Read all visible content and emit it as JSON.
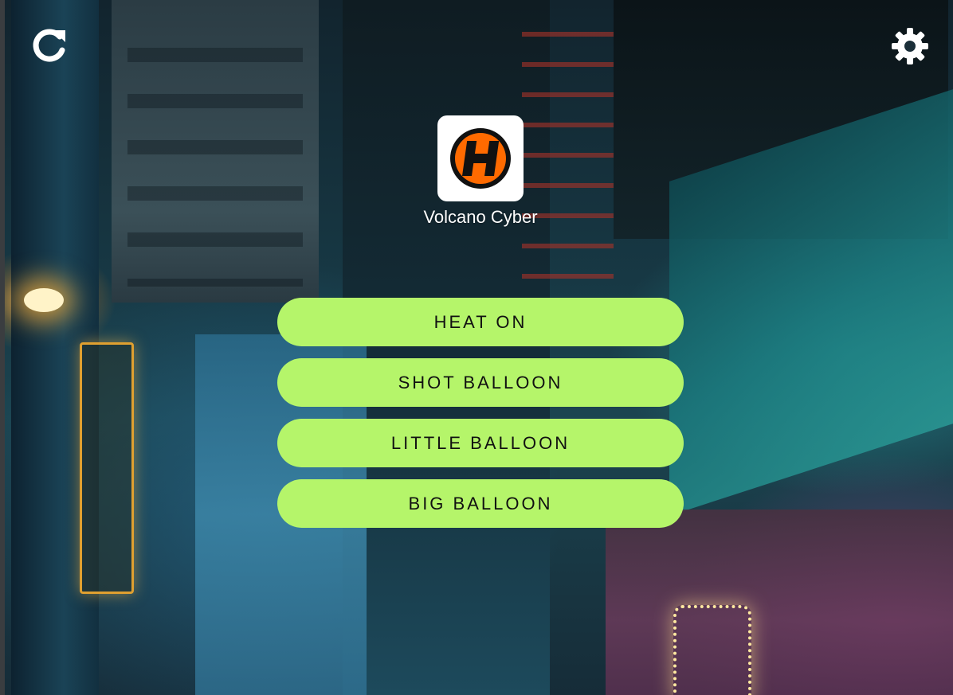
{
  "header": {
    "refresh_icon": "refresh-icon",
    "settings_icon": "gear-icon"
  },
  "device": {
    "name": "Volcano Cyber",
    "logo_icon": "volcano-logo-icon",
    "logo_colors": {
      "primary": "#ff6a00",
      "outline": "#111111"
    }
  },
  "actions": [
    {
      "id": "heat-on",
      "label": "HEAT ON"
    },
    {
      "id": "shot-balloon",
      "label": "SHOT BALLOON"
    },
    {
      "id": "little-balloon",
      "label": "LITTLE BALLOON"
    },
    {
      "id": "big-balloon",
      "label": "BIG BALLOON"
    }
  ],
  "theme": {
    "button_color": "#b5f56a",
    "button_text_color": "#111111",
    "icon_color": "#ffffff",
    "text_color": "#ffffff"
  }
}
